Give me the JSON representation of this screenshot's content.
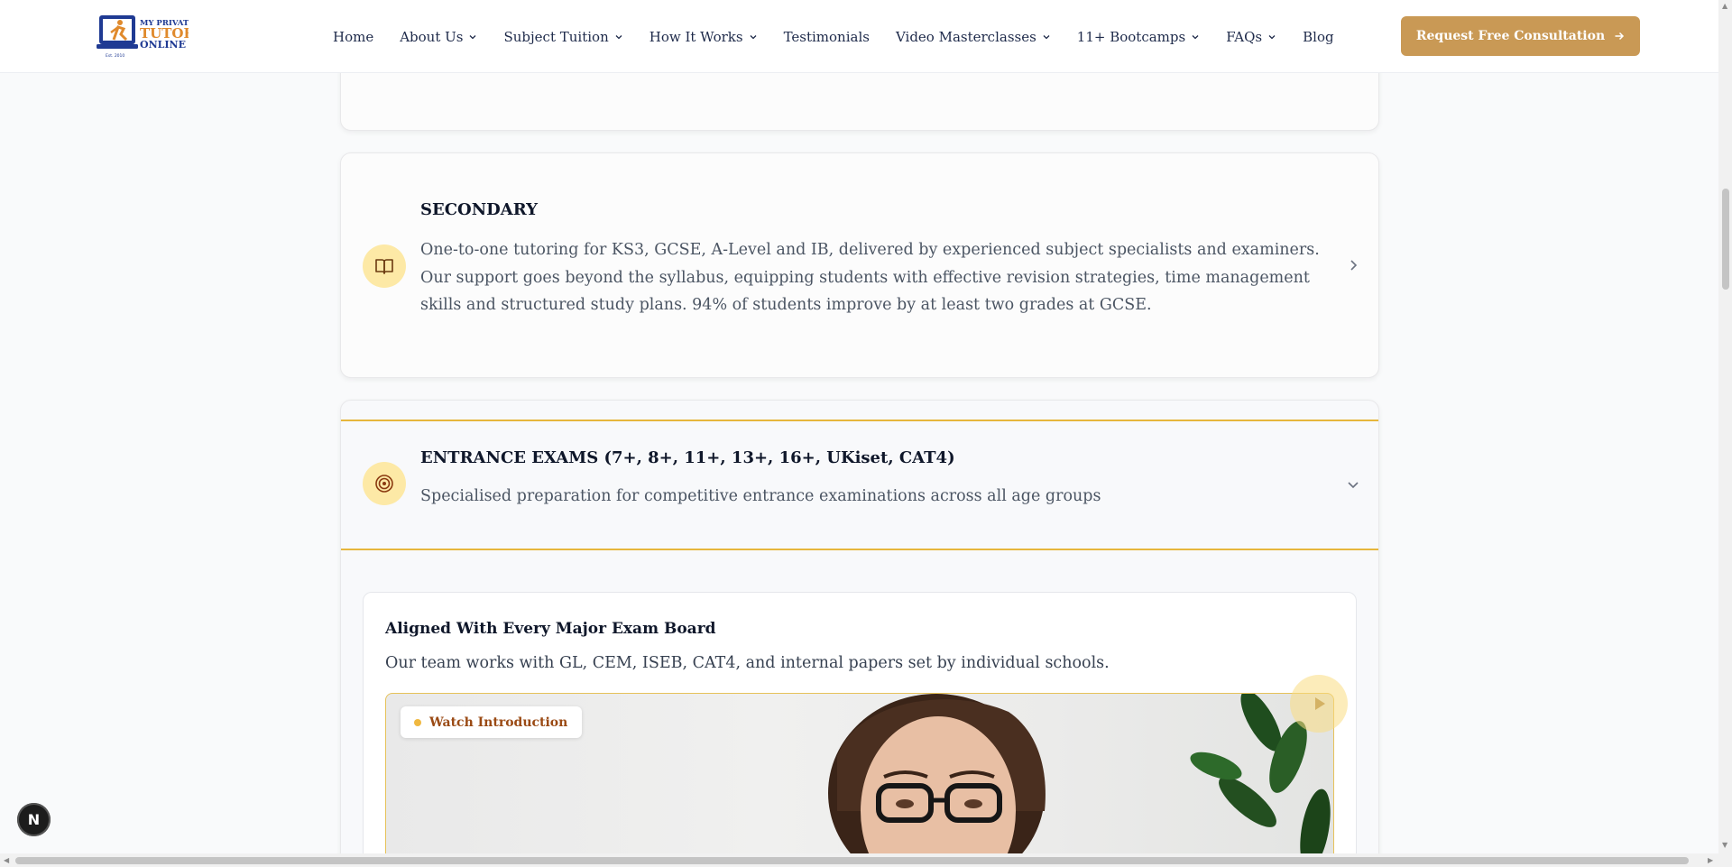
{
  "brand": {
    "logo_line1": "MY PRIVATE",
    "logo_line2": "TUTOR",
    "logo_line3": "ONLINE",
    "logo_est": "Est. 2010",
    "accent_color": "#c99955",
    "highlight_color": "#e6b63c"
  },
  "nav": {
    "items": [
      {
        "label": "Home",
        "dropdown": false
      },
      {
        "label": "About Us",
        "dropdown": true
      },
      {
        "label": "Subject Tuition",
        "dropdown": true
      },
      {
        "label": "How It Works",
        "dropdown": true
      },
      {
        "label": "Testimonials",
        "dropdown": false
      },
      {
        "label": "Video Masterclasses",
        "dropdown": true
      },
      {
        "label": "11+ Bootcamps",
        "dropdown": true
      },
      {
        "label": "FAQs",
        "dropdown": true
      },
      {
        "label": "Blog",
        "dropdown": false
      }
    ],
    "cta_label": "Request Free Consultation"
  },
  "services": {
    "secondary": {
      "title": "SECONDARY",
      "description": "One-to-one tutoring for KS3, GCSE, A-Level and IB, delivered by experienced subject specialists and examiners. Our support goes beyond the syllabus, equipping students with effective revision strategies, time management skills and structured study plans. 94% of students improve by at least two grades at GCSE.",
      "icon": "book-icon",
      "state": "collapsed"
    },
    "entrance": {
      "title": "ENTRANCE EXAMS (7+, 8+, 11+, 13+, 16+, UKiset, CAT4)",
      "description": "Specialised preparation for competitive entrance examinations across all age groups",
      "icon": "target-icon",
      "state": "expanded",
      "panel": {
        "title": "Aligned With Every Major Exam Board",
        "description": "Our team works with GL, CEM, ISEB, CAT4, and internal papers set by individual schools.",
        "video_badge": "Watch Introduction"
      }
    }
  },
  "dev_badge": "N"
}
